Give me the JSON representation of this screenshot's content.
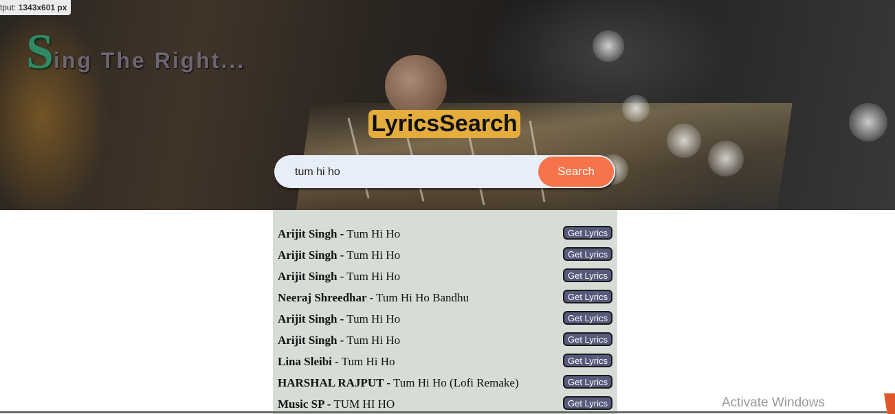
{
  "overlay": {
    "dimensions_label_prefix": "tput: ",
    "dimensions_value": "1343x601 px"
  },
  "hero": {
    "brand_first_letter": "S",
    "brand_rest": "ing The Right...",
    "app_title": "LyricsSearch"
  },
  "search": {
    "value": "tum hi ho",
    "button_label": "Search"
  },
  "results": {
    "get_lyrics_label": "Get Lyrics",
    "items": [
      {
        "artist": "Arijit Singh -",
        "title": "Tum Hi Ho"
      },
      {
        "artist": "Arijit Singh -",
        "title": "Tum Hi Ho"
      },
      {
        "artist": "Arijit Singh -",
        "title": "Tum Hi Ho"
      },
      {
        "artist": "Neeraj Shreedhar -",
        "title": "Tum Hi Ho Bandhu"
      },
      {
        "artist": "Arijit Singh -",
        "title": "Tum Hi Ho"
      },
      {
        "artist": "Arijit Singh -",
        "title": "Tum Hi Ho"
      },
      {
        "artist": "Lina Sleibi -",
        "title": "Tum Hi Ho"
      },
      {
        "artist": "HARSHAL RAJPUT -",
        "title": "Tum Hi Ho (Lofi Remake)"
      },
      {
        "artist": "Music SP -",
        "title": "TUM HI HO"
      }
    ]
  },
  "watermark": "Activate Windows",
  "colors": {
    "title_badge": "#e4ad3c",
    "search_button": "#f7744a",
    "results_bg": "#d6dcd6",
    "lyrics_button": "#55597a",
    "brand_cap": "#2f8a63"
  }
}
